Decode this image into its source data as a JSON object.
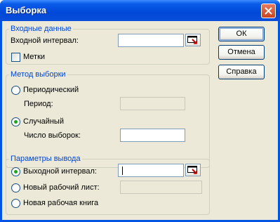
{
  "window": {
    "title": "Выборка"
  },
  "input_group": {
    "legend": "Входные данные",
    "input_range_label": "Входной интервал:",
    "input_range_value": "",
    "labels_checkbox_label": "Метки",
    "labels_checked": false
  },
  "sampling_group": {
    "legend": "Метод выборки",
    "periodic_label": "Периодический",
    "period_label": "Период:",
    "period_value": "",
    "random_label": "Случайный",
    "sample_count_label": "Число выборок:",
    "sample_count_value": "",
    "selected": "random"
  },
  "output_group": {
    "legend": "Параметры вывода",
    "output_range_label": "Выходной интервал:",
    "output_range_value": "",
    "new_sheet_label": "Новый рабочий лист:",
    "new_sheet_value": "",
    "new_workbook_label": "Новая рабочая книга",
    "selected": "output_range"
  },
  "buttons": {
    "ok": "ОК",
    "cancel": "Отмена",
    "help": "Справка"
  },
  "icons": {
    "close": "close-icon",
    "range_picker": "range-selector-icon"
  }
}
